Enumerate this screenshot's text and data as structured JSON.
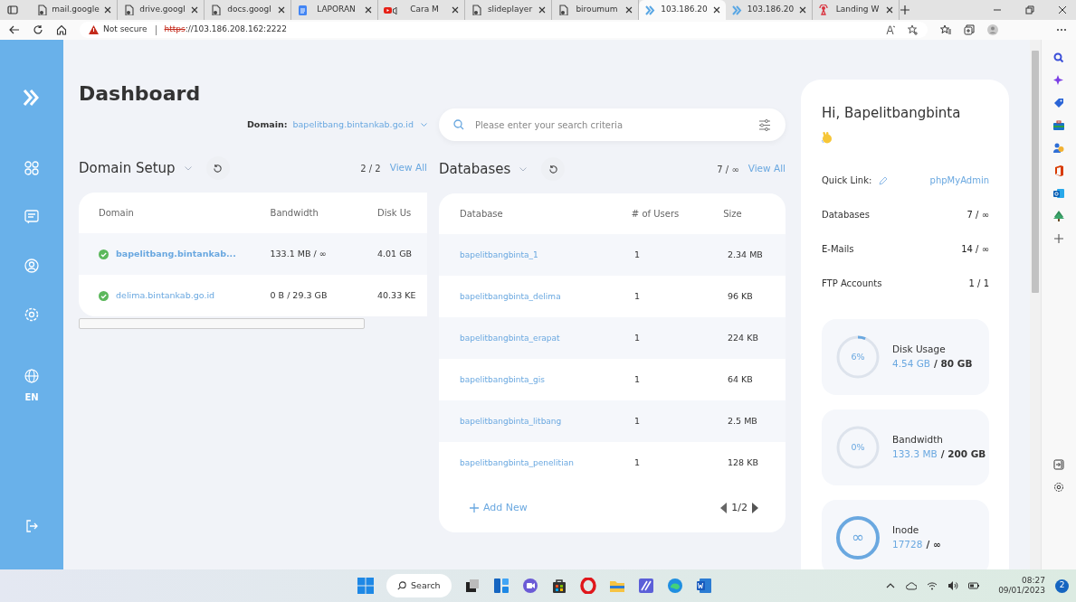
{
  "browser": {
    "tabs": [
      {
        "label": "mail.google",
        "kind": "page",
        "selected": false
      },
      {
        "label": "drive.googl",
        "kind": "page",
        "selected": false
      },
      {
        "label": "docs.googl",
        "kind": "page",
        "selected": false
      },
      {
        "label": "LAPORAN",
        "kind": "doc",
        "selected": false
      },
      {
        "label": "Cara M",
        "kind": "video",
        "selected": false
      },
      {
        "label": "slideplayer",
        "kind": "page",
        "selected": false
      },
      {
        "label": "biroumum",
        "kind": "page",
        "selected": false
      },
      {
        "label": "103.186.20",
        "kind": "panel",
        "selected": true
      },
      {
        "label": "103.186.20",
        "kind": "panel",
        "selected": false
      },
      {
        "label": "Landing W",
        "kind": "signal",
        "selected": false
      }
    ],
    "address": {
      "warning": "Not secure",
      "scheme": "https",
      "rest": "://103.186.208.162:2222"
    }
  },
  "sidebar": {
    "language": "EN"
  },
  "page": {
    "title": "Dashboard",
    "domain_label": "Domain:",
    "domain_value": "bapelitbang.bintankab.go.id",
    "search": {
      "placeholder": "Please enter your search criteria"
    }
  },
  "domain_setup": {
    "title": "Domain Setup",
    "count": "2 / 2",
    "view_all": "View All",
    "columns": [
      "Domain",
      "Bandwidth",
      "Disk Us"
    ],
    "rows": [
      {
        "domain": "bapelitbang.bintankab...",
        "bandwidth": "133.1 MB / ∞",
        "disk": "4.01 GB",
        "ok": true
      },
      {
        "domain": "delima.bintankab.go.id",
        "bandwidth": "0 B / 29.3 GB",
        "disk": "40.33 KE",
        "ok": true
      }
    ]
  },
  "databases": {
    "title": "Databases",
    "count": "7 / ∞",
    "view_all": "View All",
    "columns": [
      "Database",
      "# of Users",
      "Size"
    ],
    "rows": [
      {
        "name": "bapelitbangbinta_1",
        "users": "1",
        "size": "2.34 MB"
      },
      {
        "name": "bapelitbangbinta_delima",
        "users": "1",
        "size": "96 KB"
      },
      {
        "name": "bapelitbangbinta_erapat",
        "users": "1",
        "size": "224 KB"
      },
      {
        "name": "bapelitbangbinta_gis",
        "users": "1",
        "size": "64 KB"
      },
      {
        "name": "bapelitbangbinta_litbang",
        "users": "1",
        "size": "2.5 MB"
      },
      {
        "name": "bapelitbangbinta_penelitian",
        "users": "1",
        "size": "128 KB"
      }
    ],
    "add_new": "Add New",
    "page": "1/2"
  },
  "account": {
    "greeting": "Hi, Bapelitbangbinta",
    "quick_link_label": "Quick Link:",
    "quick_link": "phpMyAdmin",
    "stats": [
      {
        "label": "Databases",
        "value": "7 / ∞"
      },
      {
        "label": "E-Mails",
        "value": "14 / ∞"
      },
      {
        "label": "FTP Accounts",
        "value": "1 / 1"
      }
    ],
    "usage": [
      {
        "kind": "percent",
        "center": "6%",
        "level": 0.06,
        "label": "Disk Usage",
        "used": "4.54 GB",
        "limit": "/ 80 GB"
      },
      {
        "kind": "percent",
        "center": "0%",
        "level": 0.0,
        "label": "Bandwidth",
        "used": "133.3 MB",
        "limit": "/ 200 GB"
      },
      {
        "kind": "unlimited",
        "center": "∞",
        "label": "Inode",
        "used": "17728",
        "limit": "/ ∞"
      }
    ]
  },
  "taskbar": {
    "search": "Search",
    "time": "08:27",
    "date": "09/01/2023",
    "notifications": "2"
  }
}
